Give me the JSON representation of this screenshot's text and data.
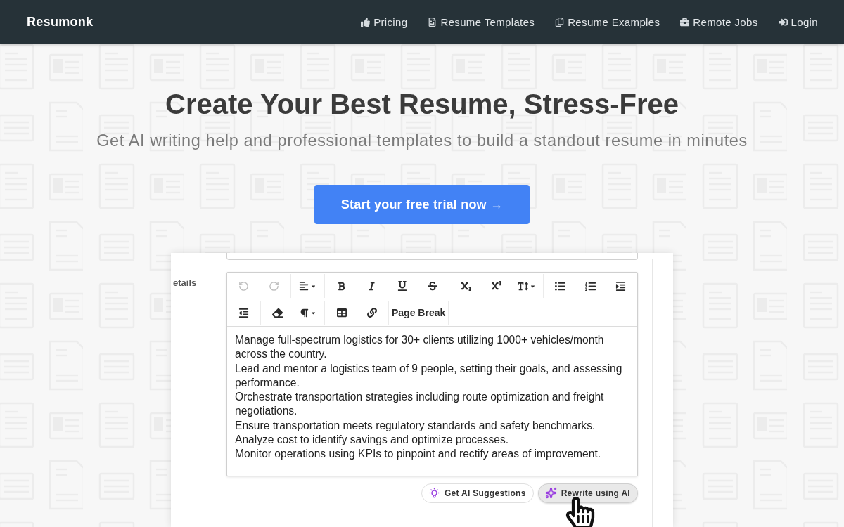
{
  "navbar": {
    "logo": "Resumonk",
    "links": [
      {
        "label": "Pricing"
      },
      {
        "label": "Resume Templates"
      },
      {
        "label": "Resume Examples"
      },
      {
        "label": "Remote Jobs"
      },
      {
        "label": "Login"
      }
    ]
  },
  "hero": {
    "title": "Create Your Best Resume, Stress-Free",
    "subtitle": "Get AI writing help and professional templates to build a standout resume in minutes",
    "cta": "Start your free trial now →"
  },
  "form": {
    "field_label": "etails",
    "editor": {
      "toolbar": {
        "rows": [
          [
            [
              {
                "kind": "icon",
                "disabled": true
              },
              {
                "kind": "icon",
                "disabled": true
              }
            ],
            [
              {
                "kind": "dropdown",
                "disabled": false
              }
            ],
            [
              {
                "kind": "icon",
                "disabled": false
              },
              {
                "kind": "icon",
                "disabled": false
              },
              {
                "kind": "icon",
                "disabled": false
              },
              {
                "kind": "icon",
                "disabled": false
              }
            ],
            [
              {
                "kind": "icon",
                "disabled": false
              },
              {
                "kind": "icon",
                "disabled": false
              },
              {
                "kind": "dropdown",
                "disabled": false
              }
            ],
            [
              {
                "kind": "icon",
                "disabled": false
              },
              {
                "kind": "icon",
                "disabled": false
              },
              {
                "kind": "icon",
                "disabled": false
              }
            ]
          ],
          [
            [
              {
                "kind": "icon",
                "disabled": false
              }
            ],
            [
              {
                "kind": "icon",
                "disabled": false
              },
              {
                "kind": "dropdown",
                "disabled": false
              }
            ],
            [
              {
                "kind": "icon",
                "disabled": false
              },
              {
                "kind": "icon",
                "disabled": false
              }
            ],
            [
              {
                "kind": "text",
                "label": "Page Break",
                "disabled": false
              }
            ]
          ]
        ]
      },
      "content": [
        "Manage full-spectrum logistics for 30+ clients utilizing 1000+ vehicles/month across the country.",
        "Lead and mentor a logistics team of 9 people, setting their goals, and assessing performance.",
        "Orchestrate transportation strategies including route optimization and freight negotiations.",
        "Ensure transportation meets regulatory standards and safety benchmarks.",
        "Analyze cost to identify savings and optimize processes.",
        "Monitor operations using KPIs to pinpoint and rectify areas of improvement."
      ]
    },
    "ai_buttons": [
      {
        "label": "Get AI Suggestions",
        "highlighted": false
      },
      {
        "label": "Rewrite using AI",
        "highlighted": true
      }
    ]
  }
}
